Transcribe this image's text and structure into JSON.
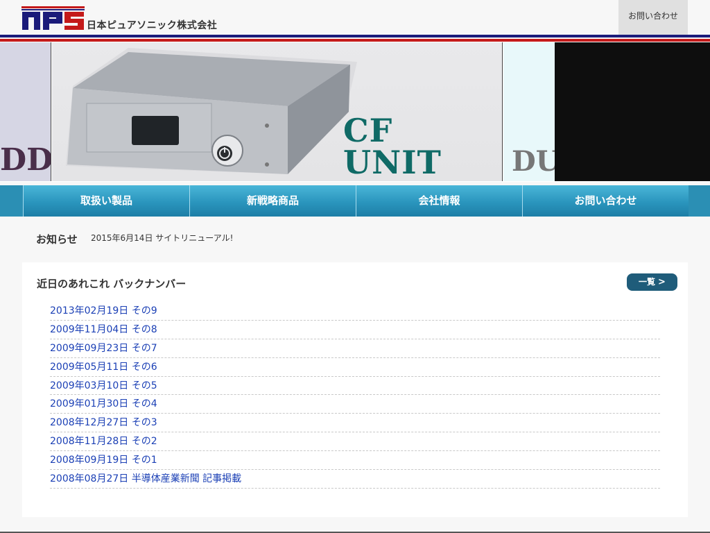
{
  "header": {
    "company_name": "日本ピュアソニック株式会社",
    "contact_label": "お問い合わせ",
    "logo_icon": "nps-logo-icon",
    "colors": {
      "blue": "#1b1b7a",
      "red": "#c41a1a"
    }
  },
  "banner": {
    "left_text": "DD",
    "main_title": "CF UNIT",
    "right_text": "DU"
  },
  "nav": {
    "items": [
      {
        "label": "取扱い製品"
      },
      {
        "label": "新戦略商品"
      },
      {
        "label": "会社情報"
      },
      {
        "label": "お問い合わせ"
      }
    ]
  },
  "notice": {
    "label": "お知らせ",
    "text": "2015年6月14日 サイトリニューアル!"
  },
  "backnumber": {
    "title": "近日のあれこれ バックナンバー",
    "list_button": "一覧",
    "list_button_icon": "chevron-right-icon",
    "items": [
      "2013年02月19日 その9",
      "2009年11月04日 その8",
      "2009年09月23日 その7",
      "2009年05月11日 その6",
      "2009年03月10日 その5",
      "2009年01月30日 その4",
      "2008年12月27日 その3",
      "2008年11月28日 その2",
      "2008年09月19日 その1",
      "2008年08月27日 半導体産業新聞 記事掲載"
    ]
  }
}
